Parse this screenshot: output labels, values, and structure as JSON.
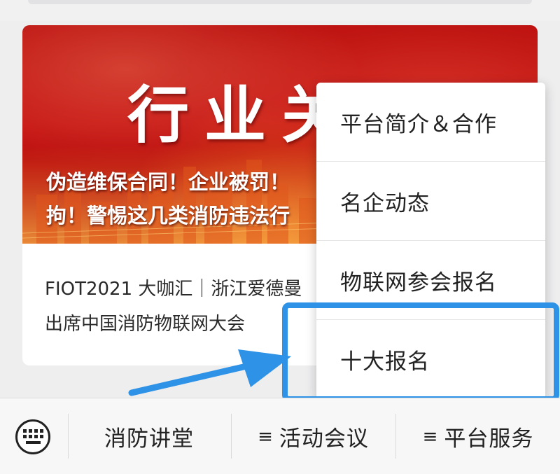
{
  "article": {
    "banner_title": "行业关注",
    "banner_headline": "伪造维保合同！企业被罚！\n拘！警惕这几类消防违法行",
    "title": "FIOT2021 大咖汇｜浙江爱德曼\n出席中国消防物联网大会"
  },
  "popup_menu": {
    "items": [
      {
        "label": "平台简介＆合作"
      },
      {
        "label": "名企动态"
      },
      {
        "label": "物联网参会报名"
      },
      {
        "label": "十大报名"
      }
    ]
  },
  "annotation": {
    "highlight_color": "#2e92e6",
    "arrow_color": "#2e92e6",
    "highlighted_item": "十大报名"
  },
  "bottom_bar": {
    "keyboard_icon": "keyboard-icon",
    "tabs": [
      {
        "label": "消防讲堂",
        "menu_marker": ""
      },
      {
        "label": "活动会议",
        "menu_marker": "≡"
      },
      {
        "label": "平台服务",
        "menu_marker": "≡"
      }
    ]
  }
}
